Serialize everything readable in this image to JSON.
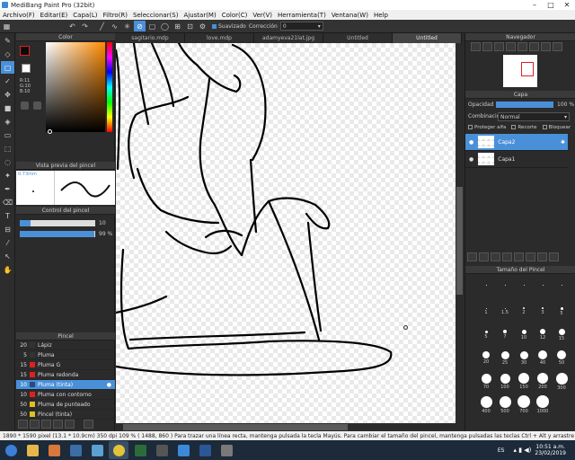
{
  "window": {
    "title": "MediBang Paint Pro (32bit)",
    "min": "–",
    "max": "□",
    "close": "✕"
  },
  "menu": [
    "Archivo(F)",
    "Editar(E)",
    "Capa(L)",
    "Filtro(R)",
    "Seleccionar(S)",
    "Ajustar(M)",
    "Color(C)",
    "Ver(V)",
    "Herramienta(T)",
    "Ventana(W)",
    "Help"
  ],
  "toolbar": {
    "smoothing_label": "Suavizado",
    "correction_label": "Corrección",
    "correction_value": "0"
  },
  "tabs": [
    "sagitario.mdp",
    "love.mdp",
    "adamyeva21lat.jpg",
    "Untitled",
    "Untitled"
  ],
  "color_panel": {
    "title": "Color",
    "r": "R:11",
    "g": "G:10",
    "b": "B:10"
  },
  "brush_preview": {
    "title": "Vista previa del pincel",
    "size": "0.73mm"
  },
  "brush_control": {
    "title": "Control del pincel",
    "size_value": "10",
    "opacity_value": "99 %"
  },
  "brush_list": {
    "title": "Pincel",
    "items": [
      {
        "size": "20",
        "name": "Lápiz",
        "color": "#333333"
      },
      {
        "size": "5",
        "name": "Pluma",
        "color": "#333333"
      },
      {
        "size": "15",
        "name": "Pluma G",
        "color": "#e02020"
      },
      {
        "size": "15",
        "name": "Pluma redonda",
        "color": "#e02020"
      },
      {
        "size": "10",
        "name": "Pluma (tinta)",
        "color": "#2a4a7a",
        "selected": true
      },
      {
        "size": "10",
        "name": "Pluma con contorno",
        "color": "#e02020"
      },
      {
        "size": "50",
        "name": "Pluma de punteado",
        "color": "#e0c020"
      },
      {
        "size": "50",
        "name": "Pincel (tinta)",
        "color": "#e0c020"
      }
    ]
  },
  "navigator": {
    "title": "Navegador"
  },
  "layer_panel": {
    "title": "Capa",
    "opacity_label": "Opacidad",
    "opacity_value": "100 %",
    "blend_label": "Combinación",
    "blend_value": "Normal",
    "protect_alpha": "Proteger alfa",
    "clip": "Recorte",
    "lock": "Bloquear",
    "layers": [
      {
        "name": "Capa2",
        "selected": true
      },
      {
        "name": "Capa1",
        "selected": false
      }
    ]
  },
  "brush_size_panel": {
    "title": "Tamaño del Pincel",
    "sizes": [
      [
        ".",
        "·",
        "·",
        "·",
        "·"
      ],
      [
        "1",
        "1.5",
        "2",
        "3",
        "5"
      ],
      [
        "5",
        "7",
        "10",
        "12",
        "15"
      ],
      [
        "20",
        "25",
        "30",
        "40",
        "50"
      ],
      [
        "70",
        "100",
        "150",
        "200",
        "300"
      ],
      [
        "400",
        "500",
        "700",
        "1000",
        ""
      ]
    ]
  },
  "status": "1890 * 1590 pixel  (13.1 * 10.9cm)  350 dpi  109 %  ( 1488, 860 )  Para trazar una línea recta, mantenga pulsada la tecla Mayús. Para cambiar el tamaño del pincel, mantenga pulsadas las teclas Ctrl + Alt y arrastre",
  "taskbar": {
    "lang": "ES",
    "time": "10:51 a.m.",
    "date": "23/02/2019"
  },
  "colors": {
    "accent": "#4a90d9",
    "panel_bg": "#2b2b2b"
  }
}
